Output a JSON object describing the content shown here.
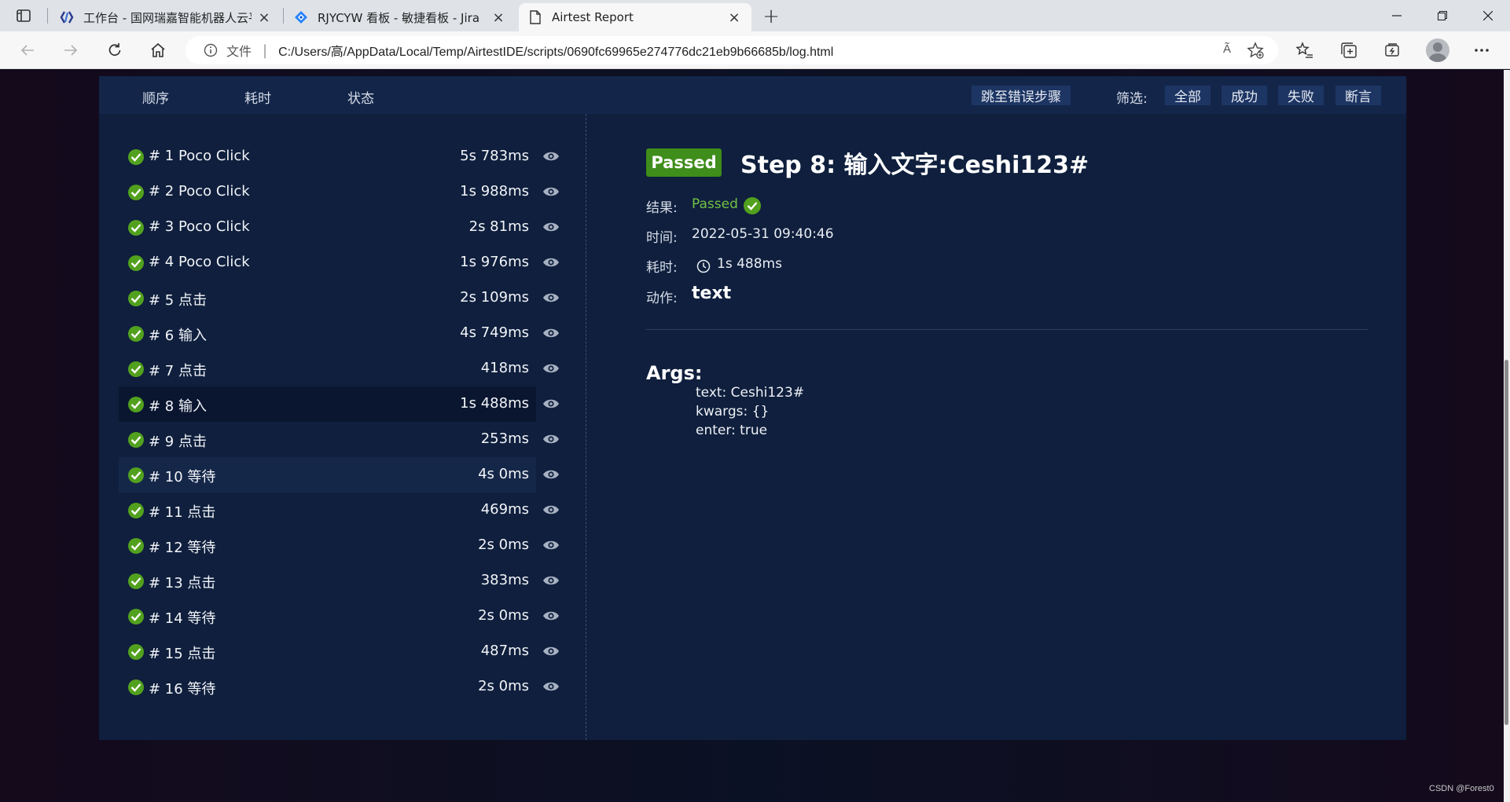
{
  "browser": {
    "tabs": [
      {
        "title": "工作台 - 国网瑞嘉智能机器人云平"
      },
      {
        "title": "RJYCYW 看板 - 敏捷看板 - Jira"
      },
      {
        "title": "Airtest Report"
      }
    ],
    "address": {
      "scheme_label": "文件",
      "url": "C:/Users/高/AppData/Local/Temp/AirtestIDE/scripts/0690fc69965e274776dc21eb9b66685b/log.html",
      "read_aloud": "Ã"
    }
  },
  "report": {
    "sort_options": [
      "顺序",
      "耗时",
      "状态"
    ],
    "jump_error_label": "跳至错误步骤",
    "filter_label": "筛选:",
    "filters": [
      "全部",
      "成功",
      "失败",
      "断言"
    ],
    "steps": [
      {
        "title": "# 1 Poco Click",
        "duration": "5s 783ms"
      },
      {
        "title": "# 2 Poco Click",
        "duration": "1s 988ms"
      },
      {
        "title": "# 3 Poco Click",
        "duration": "2s 81ms"
      },
      {
        "title": "# 4 Poco Click",
        "duration": "1s 976ms"
      },
      {
        "title": "# 5 点击",
        "duration": "2s 109ms"
      },
      {
        "title": "# 6 输入",
        "duration": "4s 749ms"
      },
      {
        "title": "# 7 点击",
        "duration": "418ms"
      },
      {
        "title": "# 8 输入",
        "duration": "1s 488ms"
      },
      {
        "title": "# 9 点击",
        "duration": "253ms"
      },
      {
        "title": "# 10 等待",
        "duration": "4s 0ms"
      },
      {
        "title": "# 11 点击",
        "duration": "469ms"
      },
      {
        "title": "# 12 等待",
        "duration": "2s 0ms"
      },
      {
        "title": "# 13 点击",
        "duration": "383ms"
      },
      {
        "title": "# 14 等待",
        "duration": "2s 0ms"
      },
      {
        "title": "# 15 点击",
        "duration": "487ms"
      },
      {
        "title": "# 16 等待",
        "duration": "2s 0ms"
      }
    ],
    "selected_step": 8,
    "detail": {
      "badge": "Passed",
      "title": "Step 8: 输入文字:Ceshi123#",
      "result_label": "结果:",
      "result_value": "Passed",
      "time_label": "时间:",
      "time_value": "2022-05-31 09:40:46",
      "duration_label": "耗时:",
      "duration_value": "1s 488ms",
      "action_label": "动作:",
      "action_value": "text",
      "args_title": "Args:",
      "args": [
        "text: Ceshi123#",
        "kwargs: {}",
        "enter: true"
      ]
    },
    "colors": {
      "passed": "#52a11e",
      "panel": "#0f1f3d",
      "header": "#13264a"
    }
  },
  "watermark": "CSDN @Forest0"
}
